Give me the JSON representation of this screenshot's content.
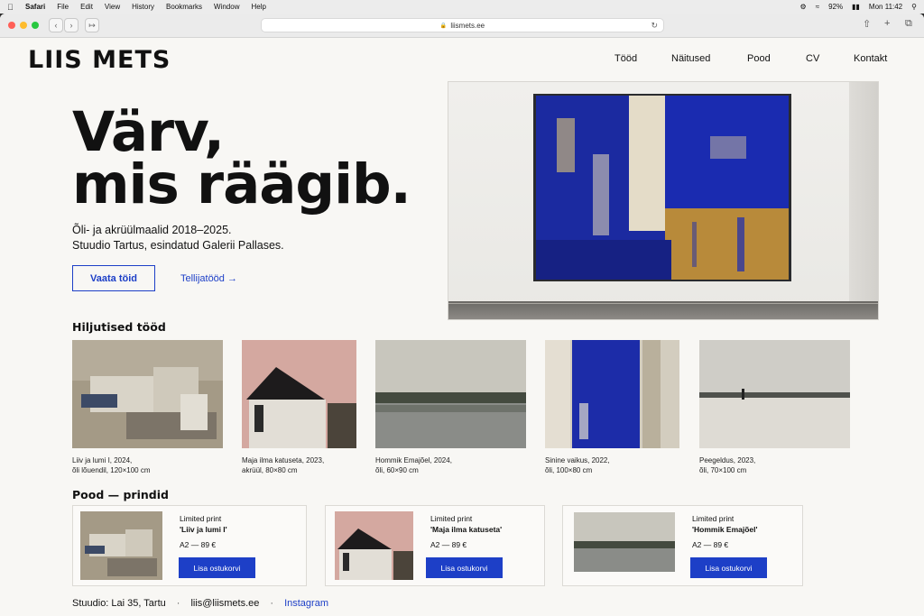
{
  "menubar": {
    "app": "Safari",
    "items": [
      "File",
      "Edit",
      "View",
      "History",
      "Bookmarks",
      "Window",
      "Help"
    ],
    "battery": "92%",
    "clock": "Mon 11:42"
  },
  "browser": {
    "url": "liismets.ee"
  },
  "site": {
    "logo": "LIIS METS",
    "nav": [
      "Tööd",
      "Näitused",
      "Pood",
      "CV",
      "Kontakt"
    ]
  },
  "hero": {
    "title_line1": "Värv,",
    "title_line2": "mis räägib.",
    "sub_line1": "Õli- ja akrüülmaalid 2018–2025.",
    "sub_line2": "Stuudio Tartus, esindatud Galerii Pallases.",
    "primary_cta": "Vaata töid",
    "secondary_cta": "Tellijatööd →"
  },
  "recent": {
    "title": "Hiljutised tööd",
    "works": [
      {
        "cap1": "Liiv ja lumi I, 2024,",
        "cap2": "õli lõuendil, 120×100 cm"
      },
      {
        "cap1": "Maja ilma katuseta, 2023,",
        "cap2": "akrüül, 80×80 cm"
      },
      {
        "cap1": "Hommik Emajõel, 2024,",
        "cap2": "õli, 60×90 cm"
      },
      {
        "cap1": "Sinine vaikus, 2022,",
        "cap2": "õli, 100×80 cm"
      },
      {
        "cap1": "Peegeldus, 2023,",
        "cap2": "õli, 70×100 cm"
      }
    ]
  },
  "shop": {
    "title": "Pood — prindid",
    "items": [
      {
        "kicker": "Limited print",
        "name": "'Liiv ja lumi I'",
        "price": "A2 — 89 €",
        "cta": "Lisa ostukorvi"
      },
      {
        "kicker": "Limited print",
        "name": "'Maja ilma katuseta'",
        "price": "A2 — 89 €",
        "cta": "Lisa ostukorvi"
      },
      {
        "kicker": "Limited print",
        "name": "'Hommik Emajõel'",
        "price": "A2 — 89 €",
        "cta": "Lisa ostukorvi"
      }
    ]
  },
  "footer": {
    "studio": "Stuudio: Lai 35, Tartu",
    "sep": "·",
    "email": "liis@liismets.ee",
    "instagram": "Instagram"
  },
  "colors": {
    "accent": "#1d3fc7",
    "background": "#f8f7f4"
  }
}
